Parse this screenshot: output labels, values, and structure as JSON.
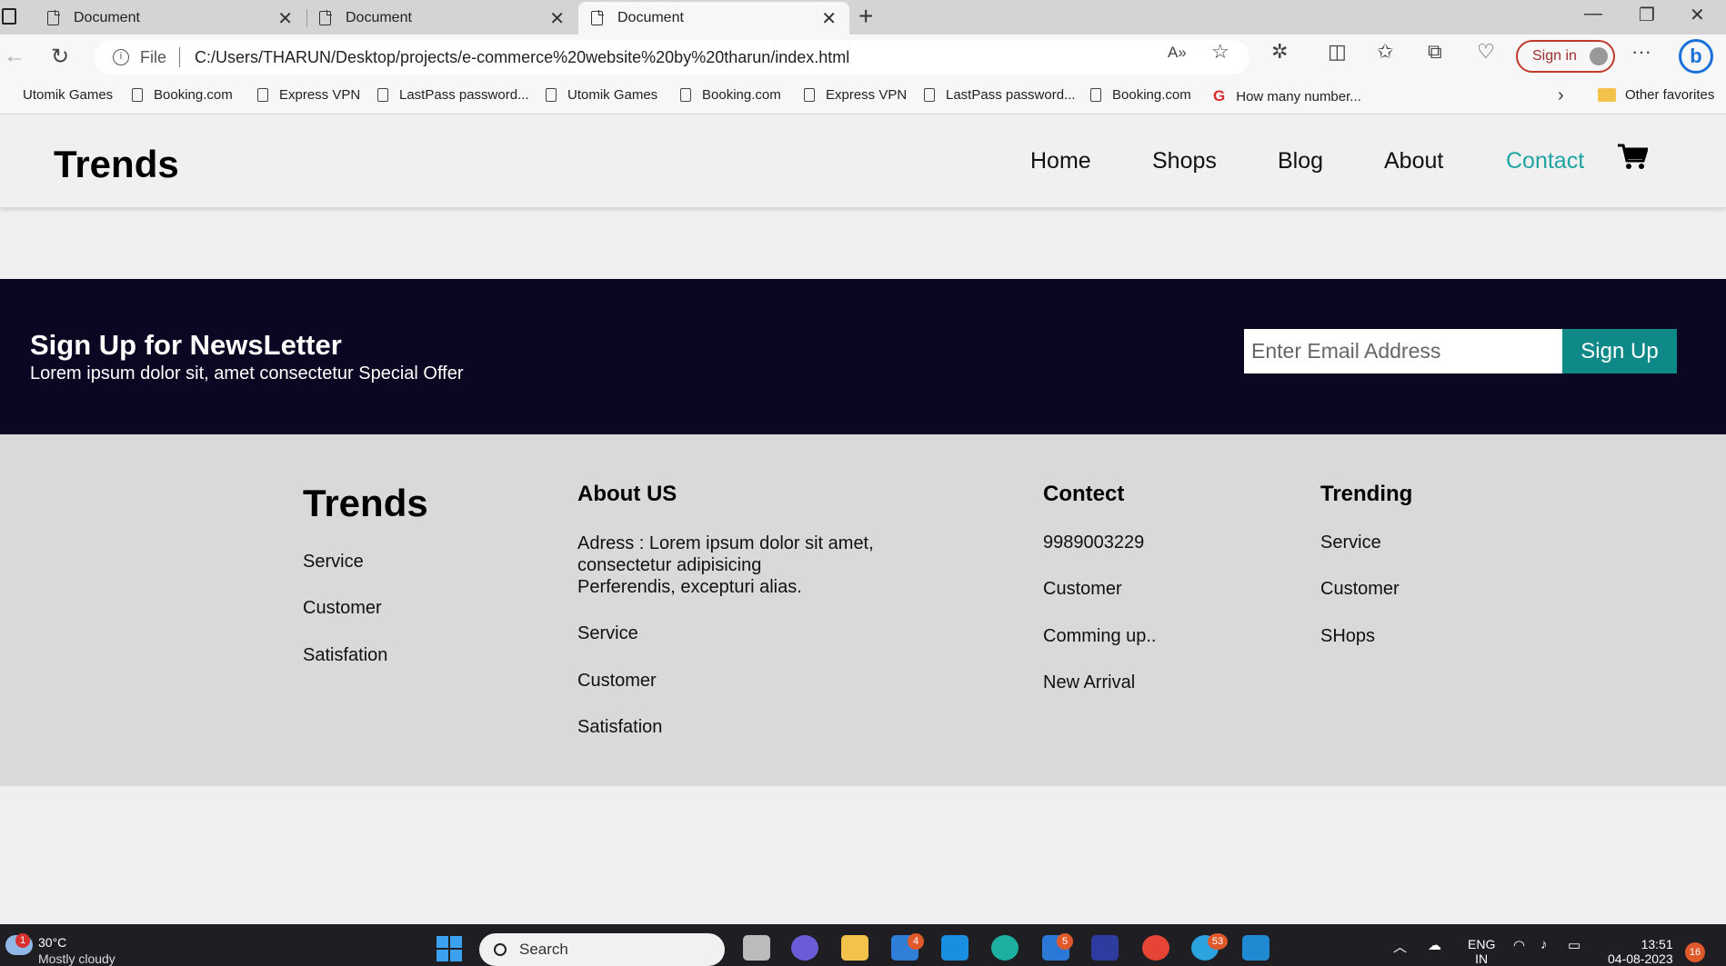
{
  "browser": {
    "tabs": [
      {
        "title": "Document"
      },
      {
        "title": "Document"
      },
      {
        "title": "Document",
        "active": true
      }
    ],
    "address": {
      "scheme_label": "File",
      "url": "C:/Users/THARUN/Desktop/projects/e-commerce%20website%20by%20tharun/index.html"
    },
    "signin_label": "Sign in",
    "favorites": [
      "Utomik Games",
      "Booking.com",
      "Express VPN",
      "LastPass password...",
      "Utomik Games",
      "Booking.com",
      "Express VPN",
      "LastPass password...",
      "Booking.com",
      "How many number..."
    ],
    "other_favorites": "Other favorites"
  },
  "site": {
    "logo": "Trends",
    "nav": [
      {
        "label": "Home"
      },
      {
        "label": "Shops"
      },
      {
        "label": "Blog"
      },
      {
        "label": "About"
      },
      {
        "label": "Contact",
        "active": true
      }
    ],
    "accent_color": "#1fa3a3"
  },
  "newsletter": {
    "title": "Sign Up for NewsLetter",
    "subtitle": "Lorem ipsum dolor sit, amet consectetur Special Offer",
    "email_placeholder": "Enter Email Address",
    "button_label": "Sign Up",
    "background_color": "#0b0722",
    "button_color": "#0f8888"
  },
  "footer": {
    "brand": {
      "title": "Trends",
      "items": [
        "Service",
        "Customer",
        "Satisfation"
      ]
    },
    "about": {
      "heading": "About US",
      "address_line1": "Adress : Lorem ipsum dolor sit amet,",
      "address_line2": "consectetur adipisicing",
      "address_line3": "Perferendis, excepturi alias.",
      "items": [
        "Service",
        "Customer",
        "Satisfation"
      ]
    },
    "contact": {
      "heading": "Contect",
      "items": [
        "9989003229",
        "Customer",
        "Comming up..",
        "New Arrival"
      ]
    },
    "trending": {
      "heading": "Trending",
      "items": [
        "Service",
        "Customer",
        "SHops"
      ]
    }
  },
  "taskbar": {
    "weather_badge": "1",
    "temperature": "30°C",
    "weather": "Mostly cloudy",
    "search_label": "Search",
    "mail_badge": "4",
    "store_badge": "5",
    "telegram_badge": "53",
    "lang_line1": "ENG",
    "lang_line2": "IN",
    "time": "13:51",
    "date": "04-08-2023",
    "notifications": "16"
  }
}
